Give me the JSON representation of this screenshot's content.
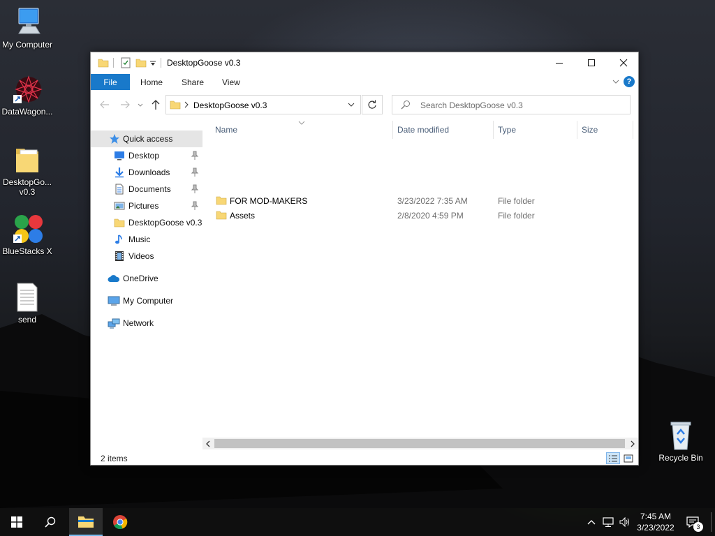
{
  "desktop": {
    "icons": [
      {
        "label": "My Computer"
      },
      {
        "label": "DataWagon..."
      },
      {
        "label": "DesktopGo... v0.3"
      },
      {
        "label": "BlueStacks X"
      },
      {
        "label": "send"
      },
      {
        "label": "Recycle Bin"
      }
    ]
  },
  "window": {
    "title": "DesktopGoose v0.3",
    "ribbon_tabs": [
      "File",
      "Home",
      "Share",
      "View"
    ],
    "help": "?",
    "address": "DesktopGoose v0.3",
    "search_placeholder": "Search DesktopGoose v0.3",
    "nav": {
      "quick_access": "Quick access",
      "items": [
        {
          "label": "Desktop",
          "icon": "desktop-icon",
          "pinned": true
        },
        {
          "label": "Downloads",
          "icon": "downloads-icon",
          "pinned": true
        },
        {
          "label": "Documents",
          "icon": "documents-icon",
          "pinned": true
        },
        {
          "label": "Pictures",
          "icon": "pictures-icon",
          "pinned": true
        },
        {
          "label": "DesktopGoose v0.3",
          "icon": "folder-icon",
          "pinned": false
        },
        {
          "label": "Music",
          "icon": "music-icon",
          "pinned": false
        },
        {
          "label": "Videos",
          "icon": "videos-icon",
          "pinned": false
        }
      ],
      "onedrive": "OneDrive",
      "mycomputer": "My Computer",
      "network": "Network"
    },
    "columns": [
      "Name",
      "Date modified",
      "Type",
      "Size"
    ],
    "files": [
      {
        "name": "FOR MOD-MAKERS",
        "date": "3/23/2022 7:35 AM",
        "type": "File folder",
        "size": ""
      },
      {
        "name": "Assets",
        "date": "2/8/2020 4:59 PM",
        "type": "File folder",
        "size": ""
      }
    ],
    "status": "2 items"
  },
  "taskbar": {
    "time": "7:45 AM",
    "date": "3/23/2022",
    "notifications": "3"
  },
  "colors": {
    "accent": "#1979ca",
    "folder": "#f8d775",
    "folder_dark": "#e0b84a"
  }
}
